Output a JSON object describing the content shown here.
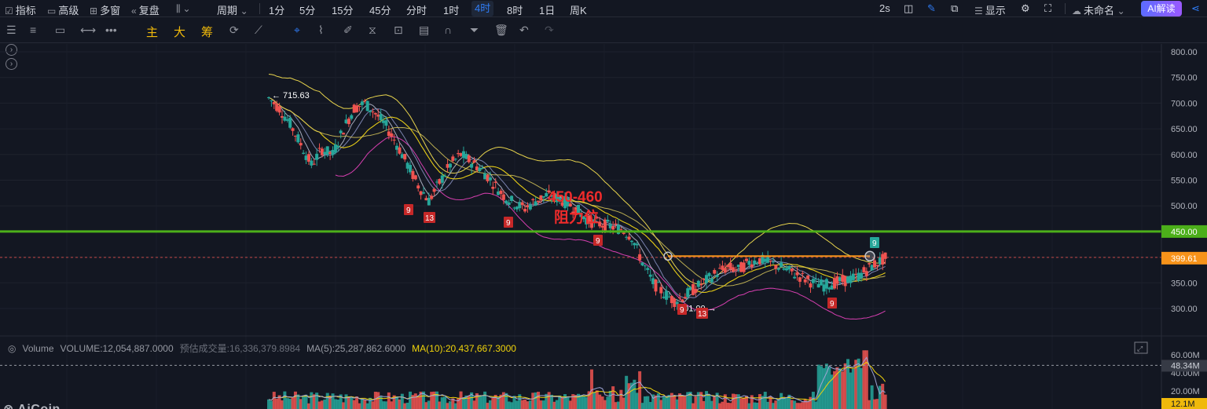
{
  "toolbar": {
    "indicators": "指标",
    "advanced": "高级",
    "multi_window": "多窗",
    "replay": "复盘",
    "period": "周期",
    "intervals": [
      "1分",
      "5分",
      "15分",
      "45分",
      "分时",
      "1时",
      "4时",
      "8时",
      "1日",
      "周K"
    ],
    "active_interval": "4时",
    "refresh": "2s",
    "display": "显示",
    "layout_name": "未命名",
    "ai_label": "AI解读"
  },
  "drawbar": {
    "main": "主",
    "big": "大",
    "chips": "筹"
  },
  "price_axis": {
    "ticks": [
      "800.00",
      "750.00",
      "700.00",
      "650.00",
      "600.00",
      "550.00",
      "500.00",
      "450.00",
      "400.00",
      "350.00",
      "300.00"
    ],
    "line_label": "450.00",
    "current_label": "399.61"
  },
  "annotations": {
    "high": "← 715.63",
    "low": "301.00 →",
    "resist_range": "450-460",
    "resist_text": "阻力位",
    "td": [
      "9",
      "13",
      "9",
      "9",
      "9",
      "13",
      "9",
      "9"
    ]
  },
  "volume_header": {
    "name": "Volume",
    "volume": "VOLUME:12,054,887.0000",
    "est": "预估成交量:16,336,379.8984",
    "ma5": "MA(5):25,287,862.6000",
    "ma10": "MA(10):20,437,667.3000"
  },
  "volume_axis": {
    "ticks": [
      "60.00M",
      "40.00M",
      "20.00M"
    ],
    "ma_label": "48.34M",
    "last_label": "12.1M"
  },
  "colors": {
    "up": "#26a69a",
    "down": "#ef5350",
    "support_line": "#4caf1a",
    "current": "#f7931a",
    "boll": "#e8d44d",
    "boll_lower": "#d63fb0"
  },
  "watermark": "AiCoin",
  "chart_data": {
    "type": "candlestick",
    "timeframe": "4h",
    "ylim": [
      280,
      820
    ],
    "close_path": [
      710,
      690,
      660,
      620,
      580,
      610,
      600,
      650,
      690,
      700,
      680,
      655,
      620,
      580,
      540,
      510,
      545,
      580,
      600,
      585,
      570,
      545,
      520,
      505,
      495,
      510,
      520,
      515,
      505,
      490,
      470,
      465,
      460,
      455,
      440,
      390,
      350,
      330,
      315,
      325,
      340,
      355,
      370,
      380,
      375,
      390,
      395,
      388,
      380,
      370,
      360,
      350,
      345,
      350,
      355,
      360,
      375,
      390,
      400
    ],
    "levels": {
      "high": 715.63,
      "low": 301.0,
      "resistance_line": 450,
      "current_price": 399.61
    }
  }
}
